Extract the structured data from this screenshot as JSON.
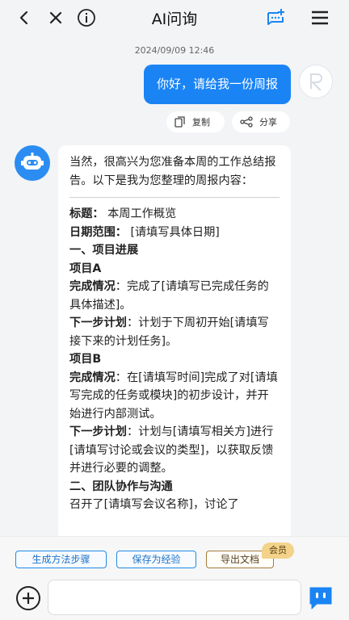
{
  "header": {
    "title": "AI问询"
  },
  "chat": {
    "timestamp": "2024/09/09 12:46",
    "user_message": "你好，请给我一份周报",
    "actions": {
      "copy": "复制",
      "share": "分享"
    },
    "bot_intro": "当然，很高兴为您准备本周的工作总结报告。以下是我为您整理的周报内容：",
    "report": [
      {
        "bold": "标题：",
        "text": " 本周工作概览"
      },
      {
        "bold": "日期范围：",
        "text": " [请填写具体日期]"
      },
      {
        "bold": "一、项目进展",
        "text": ""
      },
      {
        "bold": "项目A",
        "text": ""
      },
      {
        "bold": "完成情况",
        "text": "：完成了[请填写已完成任务的具体描述]。"
      },
      {
        "bold": "下一步计划",
        "text": "：计划于下周初开始[请填写接下来的计划任务]。"
      },
      {
        "bold": "项目B",
        "text": ""
      },
      {
        "bold": "完成情况",
        "text": "：在[请填写时间]完成了对[请填写完成的任务或模块]的初步设计，并开始进行内部测试。"
      },
      {
        "bold": "下一步计划",
        "text": "：计划与[请填写相关方]进行[请填写讨论或会议的类型]，以获取反馈并进行必要的调整。"
      },
      {
        "bold": "二、团队协作与沟通",
        "text": ""
      },
      {
        "bold": "",
        "text": "召开了[请填写会议名称]，讨论了"
      }
    ]
  },
  "quick_actions": {
    "generate_steps": "生成方法步骤",
    "save_experience": "保存为经验",
    "export_doc": "导出文档",
    "vip_badge": "会员"
  },
  "input": {
    "placeholder": ""
  },
  "colors": {
    "primary": "#1a84f5",
    "accent": "#2b8df2",
    "vip": "#f3d38a"
  }
}
